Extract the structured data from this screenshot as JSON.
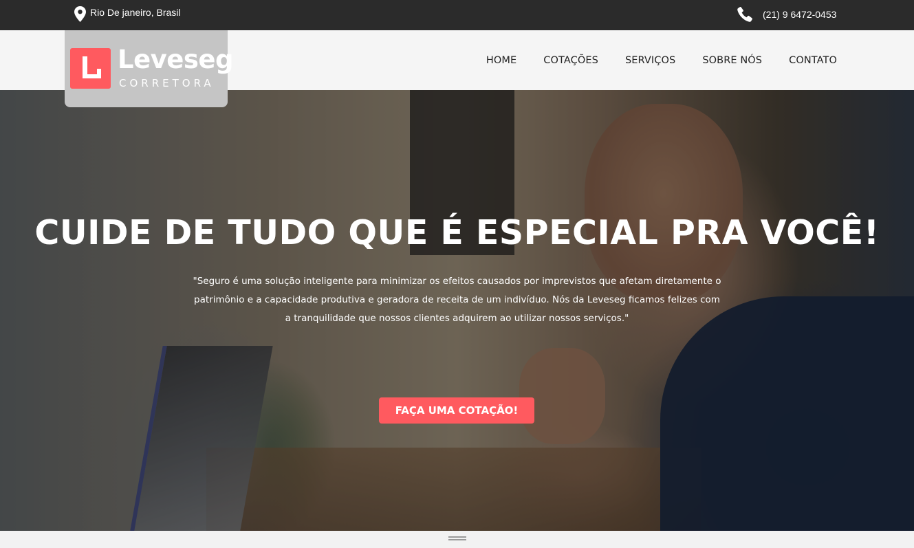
{
  "topbar": {
    "location_icon": "map-pin-icon",
    "location": "Rio De janeiro, Brasil",
    "phone_icon": "phone-icon",
    "phone": "(21) 9 6472-0453"
  },
  "brand": {
    "name": "Leveseg",
    "subtitle": "CORRETORA",
    "accent_color": "#ff5a5f"
  },
  "nav": {
    "items": [
      "HOME",
      "COTAÇÕES",
      "SERVIÇOS",
      "SOBRE NÓS",
      "CONTATO"
    ]
  },
  "hero": {
    "title": "CUIDE DE TUDO QUE É ESPECIAL PRA VOCÊ!",
    "text": "\"Seguro é uma solução inteligente para minimizar os efeitos causados por imprevistos que afetam diretamente o patrimônio e a capacidade produtiva e geradora de receita de um indivíduo. Nós da Leveseg ficamos felizes com a tranquilidade que nossos clientes adquirem ao utilizar nossos serviços.\"",
    "cta": "FAÇA UMA COTAÇÃO!"
  },
  "footer": {
    "handle_icon": "drag-handle-icon"
  }
}
